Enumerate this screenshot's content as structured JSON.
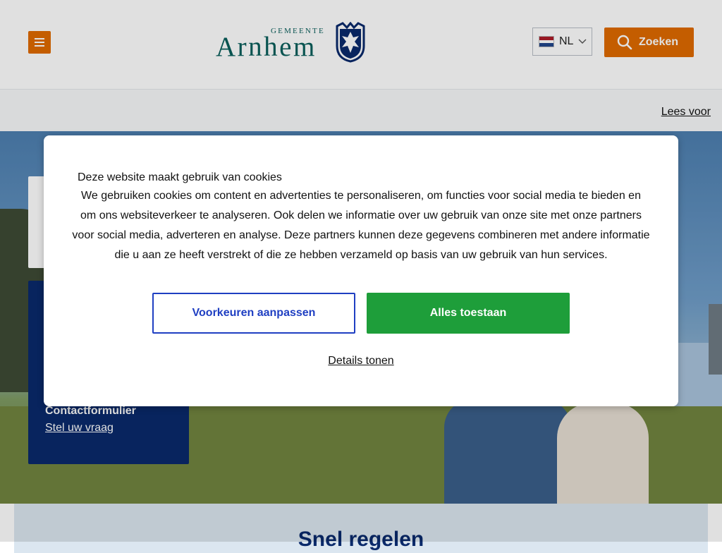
{
  "header": {
    "logo": {
      "small": "GEMEENTE",
      "big": "Arnhem"
    },
    "language": {
      "code": "NL",
      "flag_colors": [
        "#ae1c28",
        "#ffffff",
        "#21468b"
      ]
    },
    "search_label": "Zoeken",
    "accent_color": "#e06a00"
  },
  "readbar": {
    "read_aloud": "Lees voor"
  },
  "hero": {
    "contact": {
      "title": "Contactformulier",
      "link": "Stel uw vraag"
    }
  },
  "section": {
    "heading": "Snel regelen"
  },
  "cookie_dialog": {
    "title": "Deze website maakt gebruik van cookies",
    "text": "We gebruiken cookies om content en advertenties te personaliseren, om functies voor social media te bieden en om ons websiteverkeer te analyseren. Ook delen we informatie over uw gebruik van onze site met onze partners voor social media, adverteren en analyse. Deze partners kunnen deze gegevens combineren met andere informatie die u aan ze heeft verstrekt of die ze hebben verzameld op basis van uw gebruik van hun services.",
    "preferences_button": "Voorkeuren aanpassen",
    "allow_button": "Alles toestaan",
    "details_link": "Details tonen",
    "colors": {
      "preferences": "#1f3fc2",
      "allow": "#1e9e3a"
    }
  }
}
